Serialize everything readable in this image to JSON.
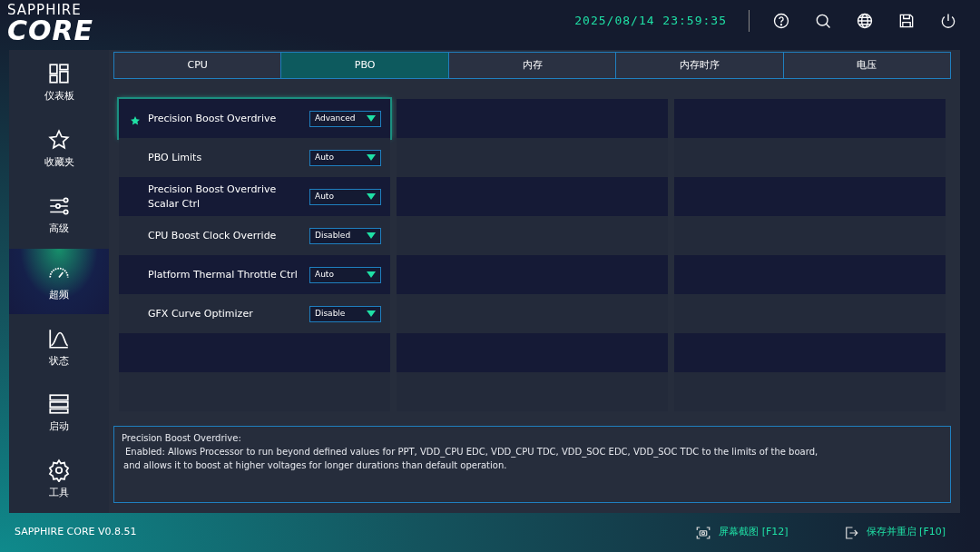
{
  "logo": {
    "brand": "SAPPHIRE",
    "product": "CORE"
  },
  "header": {
    "datetime": "2025/08/14 23:59:35"
  },
  "sidebar": {
    "items": [
      {
        "kind": "dashboard",
        "label": "仪表板",
        "selected": false
      },
      {
        "kind": "favorites",
        "label": "收藏夹",
        "selected": false
      },
      {
        "kind": "advanced",
        "label": "高级",
        "selected": false
      },
      {
        "kind": "overclock",
        "label": "超频",
        "selected": true
      },
      {
        "kind": "status",
        "label": "状态",
        "selected": false
      },
      {
        "kind": "boot",
        "label": "启动",
        "selected": false
      },
      {
        "kind": "tools",
        "label": "工具",
        "selected": false
      }
    ]
  },
  "tabs": [
    {
      "label": "CPU",
      "selected": false
    },
    {
      "label": "PBO",
      "selected": true
    },
    {
      "label": "内存",
      "selected": false
    },
    {
      "label": "内存时序",
      "selected": false
    },
    {
      "label": "电压",
      "selected": false
    }
  ],
  "settings": [
    {
      "label": "Precision Boost Overdrive",
      "value": "Advanced",
      "favorite": true,
      "selected": true
    },
    {
      "label": "PBO Limits",
      "value": "Auto",
      "favorite": false,
      "selected": false
    },
    {
      "label": "Precision Boost Overdrive Scalar Ctrl",
      "value": "Auto",
      "favorite": false,
      "selected": false
    },
    {
      "label": "CPU Boost Clock Override",
      "value": "Disabled",
      "favorite": false,
      "selected": false
    },
    {
      "label": "Platform Thermal Throttle Ctrl",
      "value": "Auto",
      "favorite": false,
      "selected": false
    },
    {
      "label": "GFX Curve Optimizer",
      "value": "Disable",
      "favorite": false,
      "selected": false
    }
  ],
  "description": {
    "title": "Precision Boost Overdrive:",
    "lines": [
      "Enabled: Allows Processor to run beyond defined values for PPT, VDD_CPU EDC, VDD_CPU TDC, VDD_SOC EDC, VDD_SOC TDC to the limits of the board,",
      "and allows it to boost at higher voltages for longer durations than default operation."
    ]
  },
  "footer": {
    "version": "SAPPHIRE CORE V0.8.51",
    "actions": [
      {
        "kind": "screenshot",
        "label": "屏幕截图 [F12]"
      },
      {
        "kind": "exit",
        "label": "保存并重启 [F10]"
      }
    ]
  }
}
